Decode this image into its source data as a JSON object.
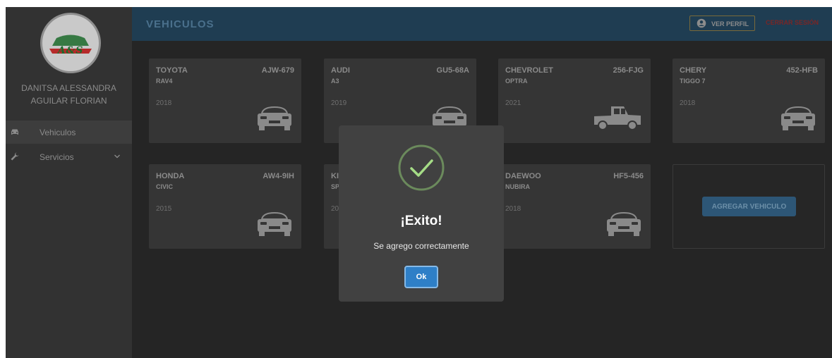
{
  "app": {
    "logo_text": "A&S"
  },
  "sidebar": {
    "user_name": "DANITSA ALESSANDRA\nAGUILAR FLORIAN",
    "items": [
      {
        "label": "Vehiculos",
        "icon": "car-icon"
      },
      {
        "label": "Servicios",
        "icon": "wrench-icon"
      }
    ]
  },
  "header": {
    "title": "VEHICULOS",
    "profile_label": "VER PERFIL",
    "logout_label": "CERRAR SESIÓN"
  },
  "vehicles": [
    {
      "brand": "TOYOTA",
      "plate": "AJW-679",
      "model": "RAV4",
      "year": "2018",
      "icon": "car-icon"
    },
    {
      "brand": "AUDI",
      "plate": "GU5-68A",
      "model": "A3",
      "year": "2019",
      "icon": "car-icon"
    },
    {
      "brand": "CHEVROLET",
      "plate": "256-FJG",
      "model": "OPTRA",
      "year": "2021",
      "icon": "pickup-truck-icon"
    },
    {
      "brand": "CHERY",
      "plate": "452-HFB",
      "model": "TIGGO 7",
      "year": "2018",
      "icon": "car-icon"
    },
    {
      "brand": "HONDA",
      "plate": "AW4-9IH",
      "model": "CIVIC",
      "year": "2015",
      "icon": "car-icon"
    },
    {
      "brand": "KI",
      "plate": "",
      "model": "SP",
      "year": "20",
      "icon": ""
    },
    {
      "brand": "DAEWOO",
      "plate": "HF5-456",
      "model": "NUBIRA",
      "year": "2018",
      "icon": "car-icon"
    }
  ],
  "add_vehicle": {
    "label": "AGREGAR VEHICULO"
  },
  "modal": {
    "icon": "checkmark-success-icon",
    "title": "¡Exito!",
    "message": "Se agrego correctamente",
    "ok_label": "Ok"
  },
  "colors": {
    "header_bg": "#1f3d52",
    "accent_blue": "#2e7fc7",
    "success_green": "#a5dc86",
    "logout_red": "#7a2626"
  }
}
